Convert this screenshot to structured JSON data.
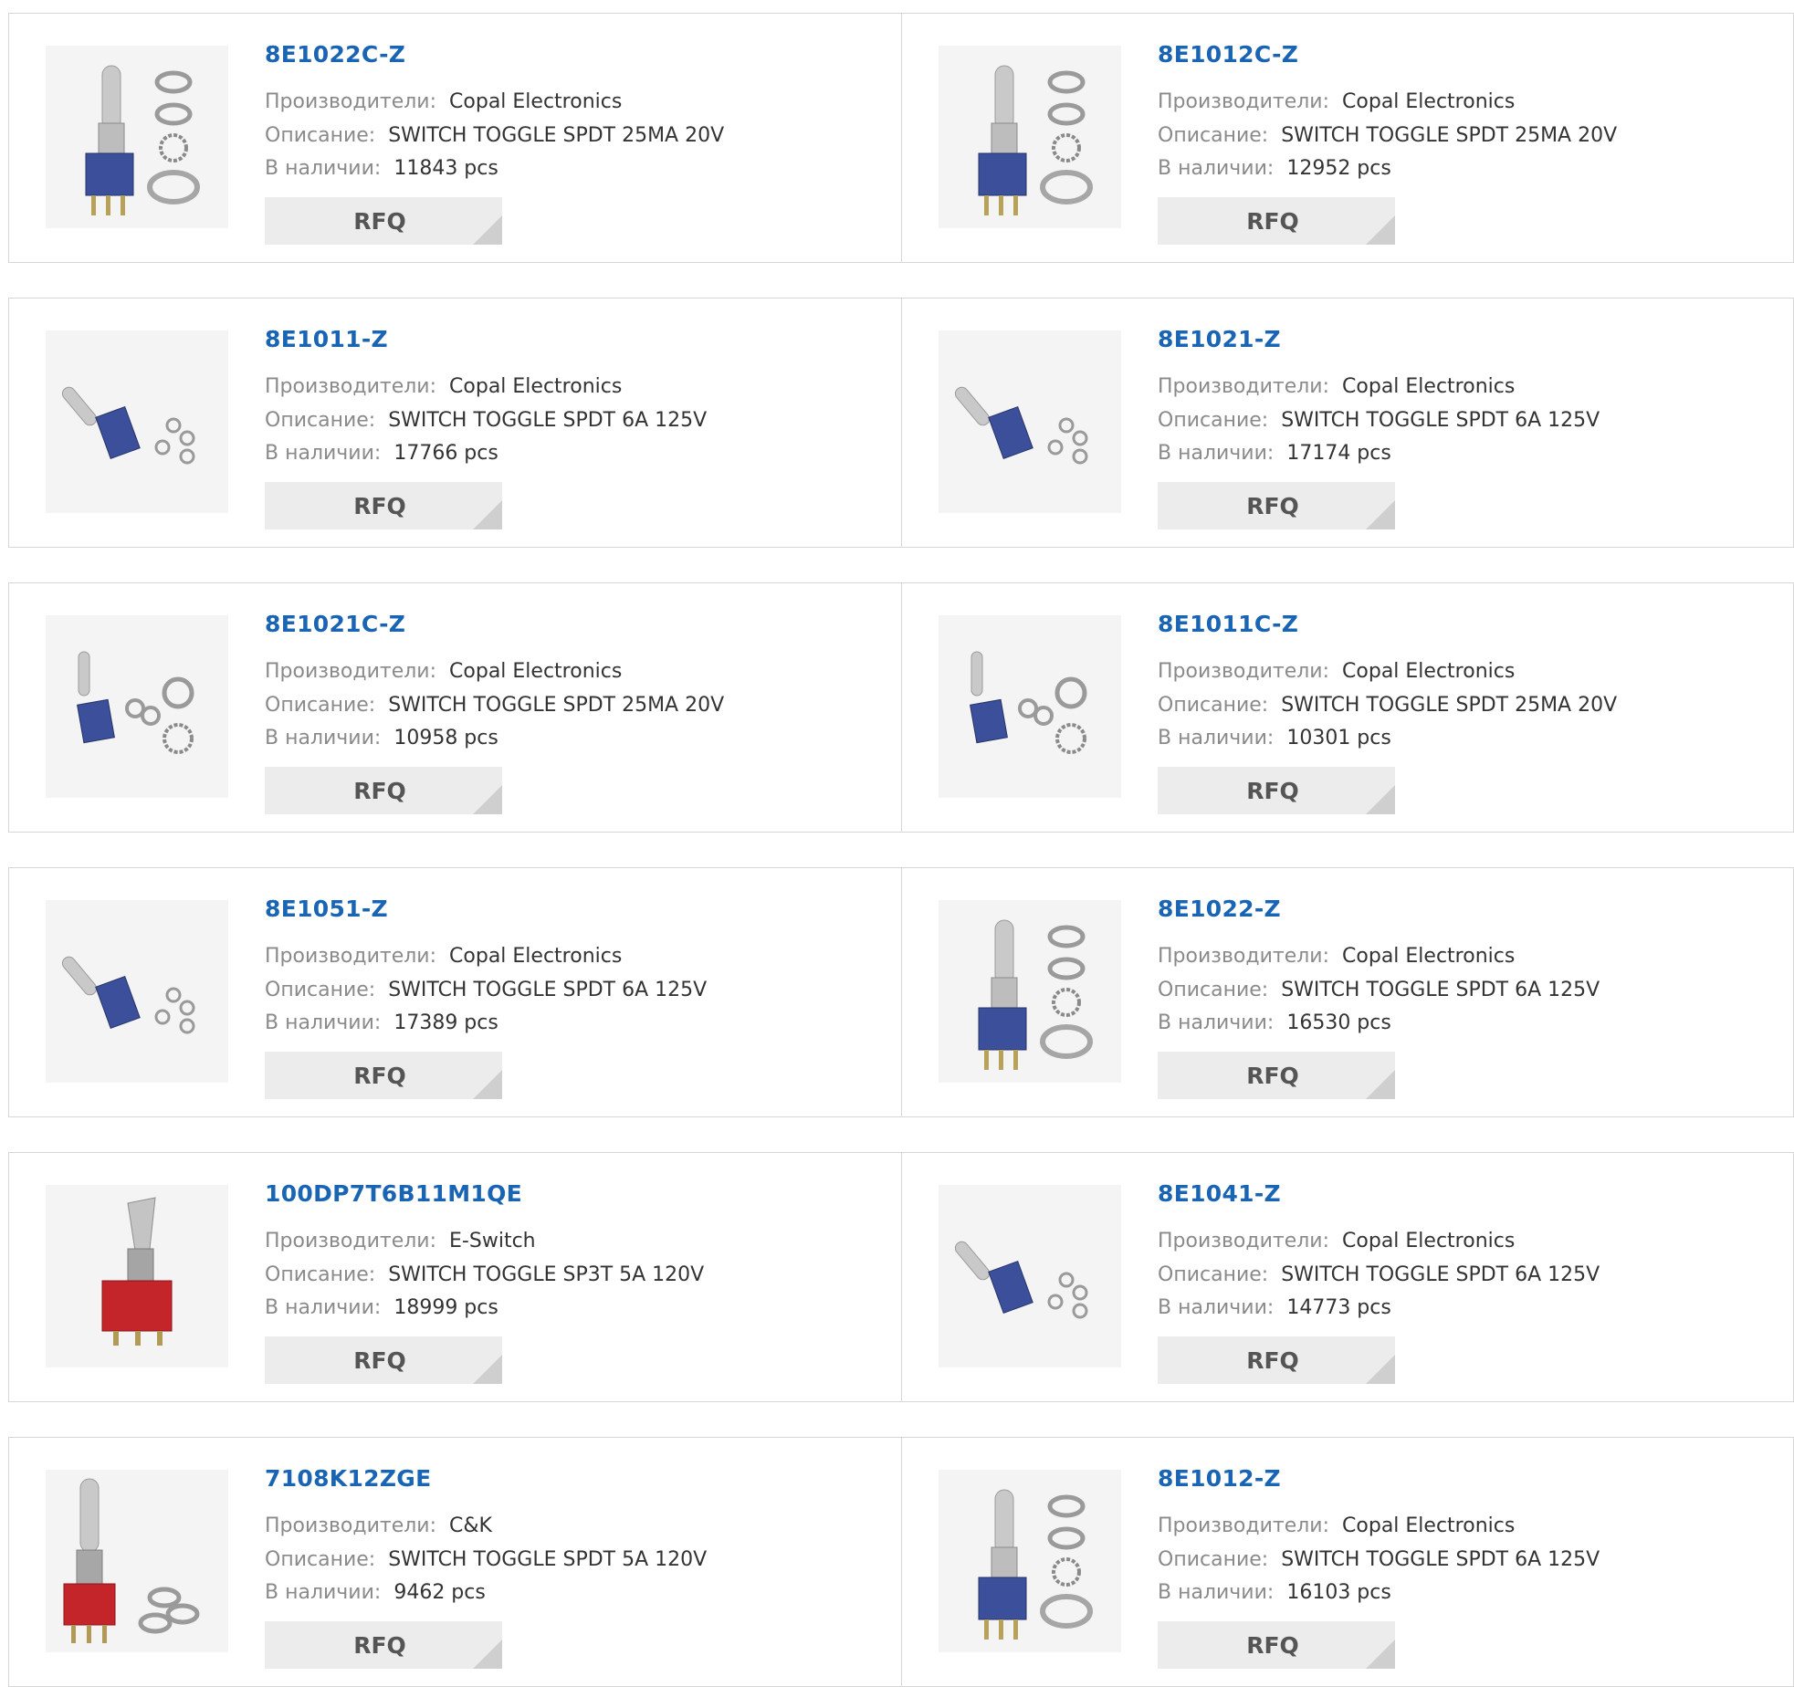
{
  "labels": {
    "manufacturer": "Производители:",
    "description": "Описание:",
    "stock": "В наличии:",
    "rfq": "RFQ"
  },
  "colors": {
    "link": "#1a64b4",
    "label": "#8a8a8a",
    "value": "#333333",
    "button": "#ececec"
  },
  "products": [
    {
      "pn": "8E1022C-Z",
      "mfr": "Copal Electronics",
      "desc": "SWITCH TOGGLE SPDT 25MA 20V",
      "stock": "11843 pcs",
      "image": "blue-switch-upright-icon"
    },
    {
      "pn": "8E1012C-Z",
      "mfr": "Copal Electronics",
      "desc": "SWITCH TOGGLE SPDT 25MA 20V",
      "stock": "12952 pcs",
      "image": "blue-switch-upright-icon"
    },
    {
      "pn": "8E1011-Z",
      "mfr": "Copal Electronics",
      "desc": "SWITCH TOGGLE SPDT 6A 125V",
      "stock": "17766 pcs",
      "image": "blue-switch-tilted-icon"
    },
    {
      "pn": "8E1021-Z",
      "mfr": "Copal Electronics",
      "desc": "SWITCH TOGGLE SPDT 6A 125V",
      "stock": "17174 pcs",
      "image": "blue-switch-tilted-icon"
    },
    {
      "pn": "8E1021C-Z",
      "mfr": "Copal Electronics",
      "desc": "SWITCH TOGGLE SPDT 25MA 20V",
      "stock": "10958 pcs",
      "image": "blue-switch-small-icon"
    },
    {
      "pn": "8E1011C-Z",
      "mfr": "Copal Electronics",
      "desc": "SWITCH TOGGLE SPDT 25MA 20V",
      "stock": "10301 pcs",
      "image": "blue-switch-small-icon"
    },
    {
      "pn": "8E1051-Z",
      "mfr": "Copal Electronics",
      "desc": "SWITCH TOGGLE SPDT 6A 125V",
      "stock": "17389 pcs",
      "image": "blue-switch-tilted-icon"
    },
    {
      "pn": "8E1022-Z",
      "mfr": "Copal Electronics",
      "desc": "SWITCH TOGGLE SPDT 6A 125V",
      "stock": "16530 pcs",
      "image": "blue-switch-upright-icon"
    },
    {
      "pn": "100DP7T6B11M1QE",
      "mfr": "E-Switch",
      "desc": "SWITCH TOGGLE SP3T 5A 120V",
      "stock": "18999 pcs",
      "image": "red-switch-paddle-icon"
    },
    {
      "pn": "8E1041-Z",
      "mfr": "Copal Electronics",
      "desc": "SWITCH TOGGLE SPDT 6A 125V",
      "stock": "14773 pcs",
      "image": "blue-switch-tilted-icon"
    },
    {
      "pn": "7108K12ZGE",
      "mfr": "C&K",
      "desc": "SWITCH TOGGLE SPDT 5A 120V",
      "stock": "9462 pcs",
      "image": "red-switch-upright-icon"
    },
    {
      "pn": "8E1012-Z",
      "mfr": "Copal Electronics",
      "desc": "SWITCH TOGGLE SPDT 6A 125V",
      "stock": "16103 pcs",
      "image": "blue-switch-upright-icon"
    }
  ]
}
